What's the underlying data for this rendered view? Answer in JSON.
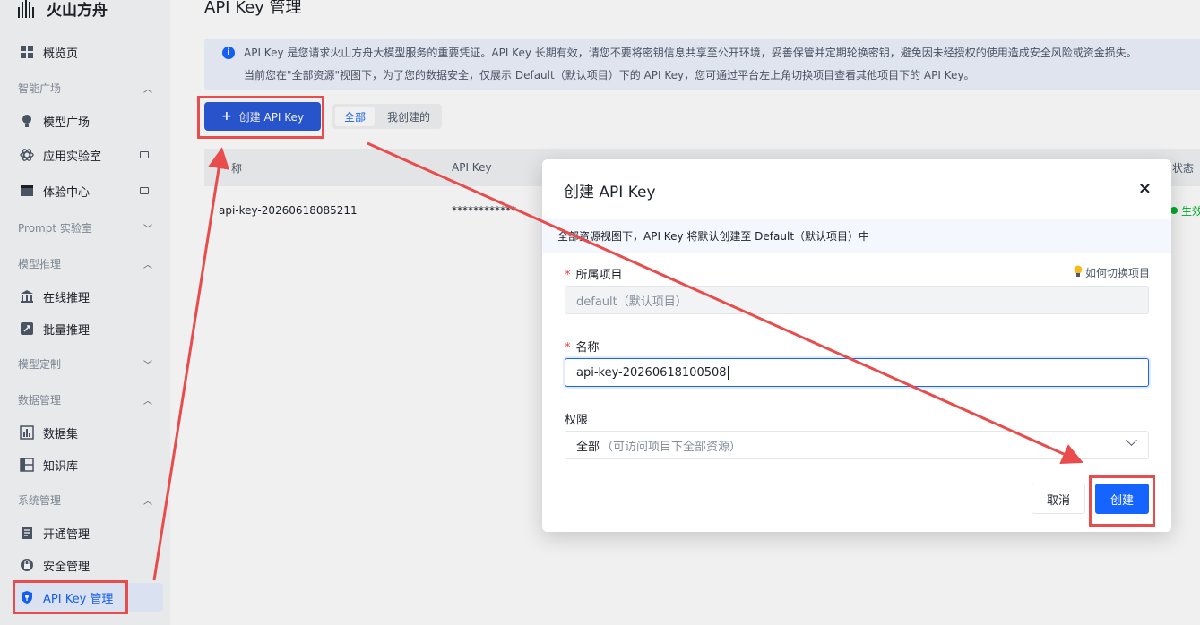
{
  "app": {
    "name": "火山方舟"
  },
  "sidebar": {
    "overview": "概览页",
    "groups": {
      "smart_square": "智能广场",
      "prompt_lab": "Prompt 实验室",
      "model_inference": "模型推理",
      "model_custom": "模型定制",
      "data_mgmt": "数据管理",
      "system_mgmt": "系统管理"
    },
    "items": {
      "model_square": "模型广场",
      "app_lab": "应用实验室",
      "experience_center": "体验中心",
      "online_inference": "在线推理",
      "batch_inference": "批量推理",
      "dataset": "数据集",
      "knowledge_base": "知识库",
      "activation": "开通管理",
      "security": "安全管理",
      "api_key": "API Key 管理"
    }
  },
  "page": {
    "title": "API Key 管理",
    "banner": {
      "line1": "API Key 是您请求火山方舟大模型服务的重要凭证。API Key 长期有效，请您不要将密钥信息共享至公开环境，妥善保管并定期轮换密钥，避免因未经授权的使用造成安全风险或资金损失。",
      "line2": "当前您在\"全部资源\"视图下，为了您的数据安全，仅展示 Default（默认项目）下的 API Key，您可通过平台左上角切换项目查看其他项目下的 API Key。"
    },
    "create_button": "创建 API Key",
    "filters": {
      "all": "全部",
      "mine": "我创建的"
    },
    "table": {
      "headers": {
        "name": "称",
        "api_key": "API Key",
        "status": "状态"
      },
      "rows": [
        {
          "name": "api-key-20260618085211",
          "api_key": "************",
          "status": "生效"
        }
      ]
    }
  },
  "modal": {
    "title": "创建 API Key",
    "close": "×",
    "tip": "全部资源视图下，API Key 将默认创建至 Default（默认项目）中",
    "project_label": "所属项目",
    "switch_project_link": "如何切换项目",
    "project_value": "default（默认项目）",
    "name_label": "名称",
    "name_value": "api-key-20260618100508",
    "permission_label": "权限",
    "permission_value": "全部",
    "permission_hint": "（可访问项目下全部资源）",
    "cancel": "取消",
    "confirm": "创建"
  },
  "colors": {
    "primary": "#1664ff",
    "annotation": "#e84c4c",
    "create_button": "#2a59d8"
  }
}
